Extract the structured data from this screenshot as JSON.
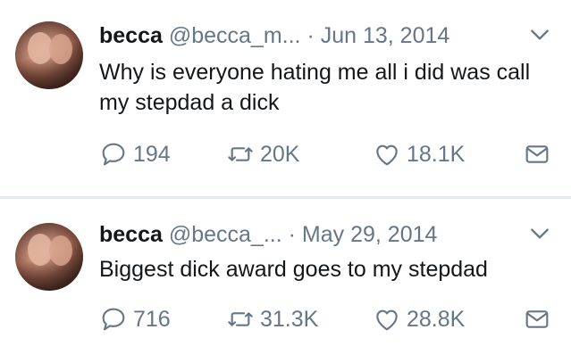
{
  "tweets": [
    {
      "name": "becca",
      "handle": "@becca_m...",
      "separator": "·",
      "date": "Jun 13, 2014",
      "text": "Why is everyone hating me all i did was call my stepdad a dick",
      "replies": "194",
      "retweets": "20K",
      "likes": "18.1K"
    },
    {
      "name": "becca",
      "handle": "@becca_...",
      "separator": "·",
      "date": "May 29, 2014",
      "text": "Biggest dick award goes to my stepdad",
      "replies": "716",
      "retweets": "31.3K",
      "likes": "28.8K"
    }
  ],
  "icons": {
    "reply": "speech-bubble-icon",
    "retweet": "retweet-arrows-icon",
    "like": "heart-icon",
    "dm": "envelope-icon",
    "menu": "chevron-down-icon"
  },
  "colors": {
    "text": "#14171a",
    "secondary": "#657786",
    "divider": "#e6ecf0"
  }
}
